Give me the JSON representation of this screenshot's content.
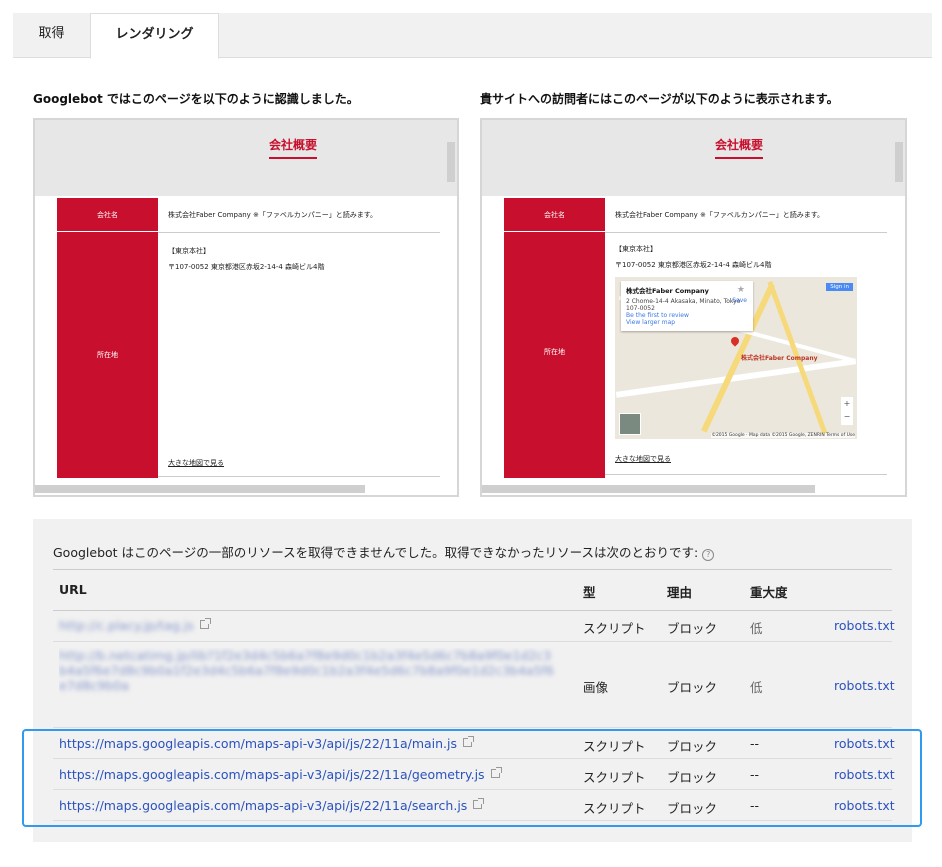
{
  "tabs": [
    {
      "label": "取得"
    },
    {
      "label": "レンダリング"
    }
  ],
  "googlebot_view": {
    "title": "Googlebot ではこのページを以下のように認識しました。",
    "heading": "会社概要",
    "company_label": "会社名",
    "company_value": "株式会社Faber Company ※「ファベルカンパニー」と読みます。",
    "address_label": "所在地",
    "office": "【東京本社】",
    "address": "〒107-0052 東京都港区赤坂2-14-4 森崎ビル4階",
    "map_link": "大きな地図で見る"
  },
  "visitor_view": {
    "title": "貴サイトへの訪問者にはこのページが以下のように表示されます。",
    "heading": "会社概要",
    "company_label": "会社名",
    "company_value": "株式会社Faber Company ※「ファベルカンパニー」と読みます。",
    "address_label": "所在地",
    "office": "【東京本社】",
    "address": "〒107-0052 東京都港区赤坂2-14-4 森崎ビル4階",
    "map_link": "大きな地図で見る",
    "map": {
      "card_title": "株式会社Faber Company",
      "card_address": "2 Chome-14-4 Akasaka, Minato, Tokyo 107-0052",
      "card_review": "Be the first to review",
      "card_larger": "View larger map",
      "save": "Save",
      "pin_label": "株式会社Faber Company",
      "signin": "Sign in",
      "zoom_in": "+",
      "zoom_out": "−",
      "copyright": "©2015 Google · Map data ©2015 Google, ZENRIN  Terms of Use"
    }
  },
  "resources": {
    "message": "Googlebot はこのページの一部のリソースを取得できませんでした。取得できなかったリソースは次のとおりです:",
    "help_icon": "?",
    "headers": {
      "url": "URL",
      "type": "型",
      "reason": "理由",
      "severity": "重大度"
    },
    "rows": [
      {
        "url": "http://c.placy.jp/tag.js",
        "type": "スクリプト",
        "reason": "ブロック",
        "severity": "低",
        "rule": "robots.txt"
      },
      {
        "url": "http://b.netcatimg.jp/lib?1f2e3d4c5b6a7f8e9d0c1b2a3f4e5d6c7b8a9f0e1d2c3b4a5f6e7d8c9b0a1f2e3d4c5b6a7f8e9d0c1b2a3f4e5d6c7b8a9f0e1d2c3b4a5f6e7d8c9b0a",
        "type": "画像",
        "reason": "ブロック",
        "severity": "低",
        "rule": "robots.txt"
      },
      {
        "url": "https://maps.googleapis.com/maps-api-v3/api/js/22/11a/main.js",
        "type": "スクリプト",
        "reason": "ブロック",
        "severity": "--",
        "rule": "robots.txt"
      },
      {
        "url": "https://maps.googleapis.com/maps-api-v3/api/js/22/11a/geometry.js",
        "type": "スクリプト",
        "reason": "ブロック",
        "severity": "--",
        "rule": "robots.txt"
      },
      {
        "url": "https://maps.googleapis.com/maps-api-v3/api/js/22/11a/search.js",
        "type": "スクリプト",
        "reason": "ブロック",
        "severity": "--",
        "rule": "robots.txt"
      }
    ]
  },
  "colors": {
    "brand_red": "#c8102e",
    "link_blue": "#2a52be",
    "highlight_blue": "#2e9bf0"
  }
}
